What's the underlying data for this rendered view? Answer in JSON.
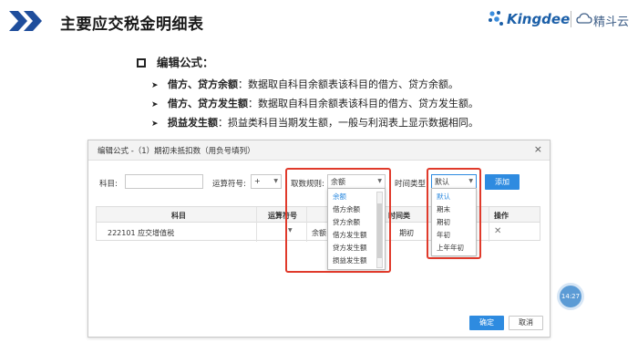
{
  "header": {
    "title": "主要应交税金明细表",
    "logo_brand": "Kingdee",
    "logo_product": "精斗云",
    "colors": {
      "chevron": "#1f4e9c",
      "brand": "#1b5fa8"
    }
  },
  "bullets": {
    "main": "编辑公式：",
    "items": [
      {
        "term": "借方、贷方余额",
        "sep": "：",
        "desc": "数据取自科目余额表该科目的借方、贷方余额。"
      },
      {
        "term": "借方、贷方发生额",
        "sep": "：",
        "desc": "数据取自科目余额表该科目的借方、贷方发生额。"
      },
      {
        "term": "损益发生额",
        "sep": "：",
        "desc": "损益类科目当期发生额，一般与利润表上显示数据相同。"
      }
    ]
  },
  "dialog": {
    "title": "编辑公式 -（1）期初未抵扣数（用负号填列）",
    "close_glyph": "×",
    "account_label": "科目:",
    "account_value": "",
    "operator_label": "运算符号:",
    "operator_value": "+",
    "rule_label": "取数规则:",
    "rule_value": "余额",
    "time_label": "时间类型:",
    "time_value": "默认",
    "add_button": "添加",
    "table": {
      "headers": {
        "account": "科目",
        "operator": "运算符号",
        "time": "时间类",
        "ops": "操作"
      },
      "row": {
        "account": "222101 应交增值税",
        "rule": "余额",
        "time": "期初",
        "delete": "✕"
      }
    },
    "rule_options": [
      "余额",
      "借方余额",
      "贷方余额",
      "借方发生额",
      "贷方发生额",
      "损益发生额"
    ],
    "time_options": [
      "默认",
      "期末",
      "期初",
      "年初",
      "上年年初"
    ],
    "ok_button": "确定",
    "cancel_button": "取消"
  },
  "badge": {
    "time": "14:27"
  },
  "colors": {
    "accent": "#2e8be0",
    "highlight": "#e03a2b"
  }
}
